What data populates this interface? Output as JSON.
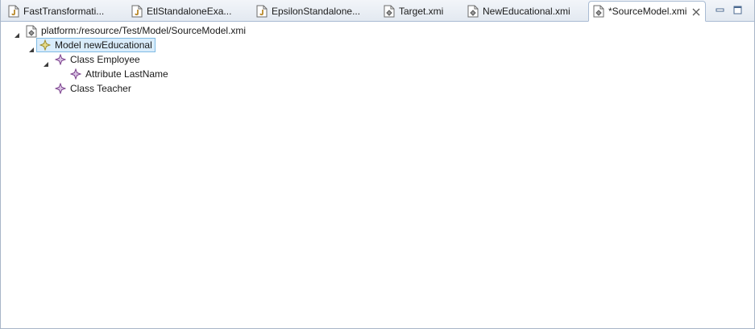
{
  "tabs": [
    {
      "label": "FastTransformati...",
      "icon": "java-file-icon",
      "active": false
    },
    {
      "label": "EtlStandaloneExa...",
      "icon": "java-file-icon",
      "active": false
    },
    {
      "label": "EpsilonStandalone...",
      "icon": "java-file-icon",
      "active": false
    },
    {
      "label": "Target.xmi",
      "icon": "xmi-file-icon",
      "active": false
    },
    {
      "label": "NewEducational.xmi",
      "icon": "xmi-file-icon",
      "active": false
    },
    {
      "label": "*SourceModel.xmi",
      "icon": "xmi-file-icon",
      "active": true
    }
  ],
  "window_controls": {
    "minimize": "minimize-icon",
    "maximize": "maximize-icon"
  },
  "tree": {
    "root": {
      "label": "platform:/resource/Test/Model/SourceModel.xmi",
      "expanded": true
    },
    "nodes": [
      {
        "label": "Model newEducational",
        "selected": true,
        "expanded": true
      },
      {
        "label": "Class Employee",
        "expanded": true
      },
      {
        "label": "Attribute LastName"
      },
      {
        "label": "Class Teacher"
      }
    ]
  },
  "colors": {
    "selection_bg": "#d9ecfb",
    "selection_border": "#7fbbe4",
    "tabbar_border": "#a9bbd3",
    "model_icon": "#c9b85a",
    "class_icon": "#8a4a9a"
  }
}
